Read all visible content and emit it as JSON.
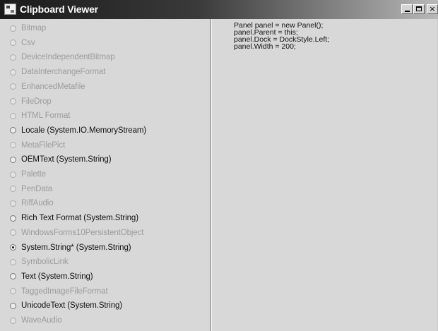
{
  "window": {
    "title": "Clipboard Viewer",
    "min_symbol": "_",
    "close_symbol": "×"
  },
  "formats": [
    {
      "label": "Bitmap",
      "enabled": false,
      "checked": false
    },
    {
      "label": "Csv",
      "enabled": false,
      "checked": false
    },
    {
      "label": "DeviceIndependentBitmap",
      "enabled": false,
      "checked": false
    },
    {
      "label": "DataInterchangeFormat",
      "enabled": false,
      "checked": false
    },
    {
      "label": "EnhancedMetafile",
      "enabled": false,
      "checked": false
    },
    {
      "label": "FileDrop",
      "enabled": false,
      "checked": false
    },
    {
      "label": "HTML Format",
      "enabled": false,
      "checked": false
    },
    {
      "label": "Locale (System.IO.MemoryStream)",
      "enabled": true,
      "checked": false
    },
    {
      "label": "MetaFilePict",
      "enabled": false,
      "checked": false
    },
    {
      "label": "OEMText (System.String)",
      "enabled": true,
      "checked": false
    },
    {
      "label": "Palette",
      "enabled": false,
      "checked": false
    },
    {
      "label": "PenData",
      "enabled": false,
      "checked": false
    },
    {
      "label": "RiffAudio",
      "enabled": false,
      "checked": false
    },
    {
      "label": "Rich Text Format (System.String)",
      "enabled": true,
      "checked": false
    },
    {
      "label": "WindowsForms10PersistentObject",
      "enabled": false,
      "checked": false
    },
    {
      "label": "System.String* (System.String)",
      "enabled": true,
      "checked": true
    },
    {
      "label": "SymbolicLink",
      "enabled": false,
      "checked": false
    },
    {
      "label": "Text (System.String)",
      "enabled": true,
      "checked": false
    },
    {
      "label": "TaggedImageFileFormat",
      "enabled": false,
      "checked": false
    },
    {
      "label": "UnicodeText (System.String)",
      "enabled": true,
      "checked": false
    },
    {
      "label": "WaveAudio",
      "enabled": false,
      "checked": false
    }
  ],
  "content": {
    "text": "Panel panel = new Panel();\npanel.Parent = this;\npanel.Dock = DockStyle.Left;\npanel.Width = 200;"
  }
}
